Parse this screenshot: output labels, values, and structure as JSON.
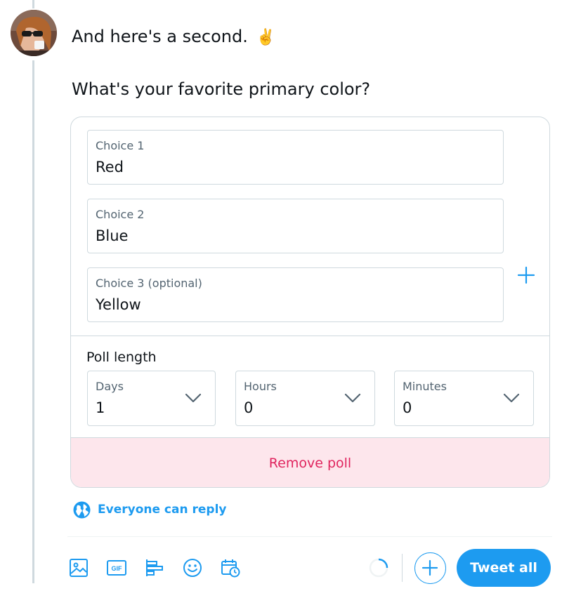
{
  "tweet": {
    "text": "And here's a second.",
    "emoji": "✌️",
    "avatar_icon": "user-avatar-photo"
  },
  "poll": {
    "question": "What's your favorite primary color?",
    "choices": [
      {
        "label": "Choice 1",
        "value": "Red"
      },
      {
        "label": "Choice 2",
        "value": "Blue"
      },
      {
        "label": "Choice 3 (optional)",
        "value": "Yellow"
      }
    ],
    "add_choice_icon": "plus-icon",
    "length_title": "Poll length",
    "length": {
      "days": {
        "label": "Days",
        "value": "1"
      },
      "hours": {
        "label": "Hours",
        "value": "0"
      },
      "minutes": {
        "label": "Minutes",
        "value": "0"
      }
    },
    "remove_label": "Remove poll"
  },
  "reply_setting": {
    "label": "Everyone can reply",
    "icon": "globe-icon"
  },
  "toolbar": {
    "icons": [
      "image-icon",
      "gif-icon",
      "poll-icon",
      "emoji-icon",
      "schedule-icon"
    ],
    "gif_text": "GIF",
    "tweet_all_label": "Tweet all"
  },
  "colors": {
    "accent": "#1d9bf0",
    "danger": "#e0245e",
    "danger_bg": "#fde6ec",
    "border": "#cfd9de"
  }
}
